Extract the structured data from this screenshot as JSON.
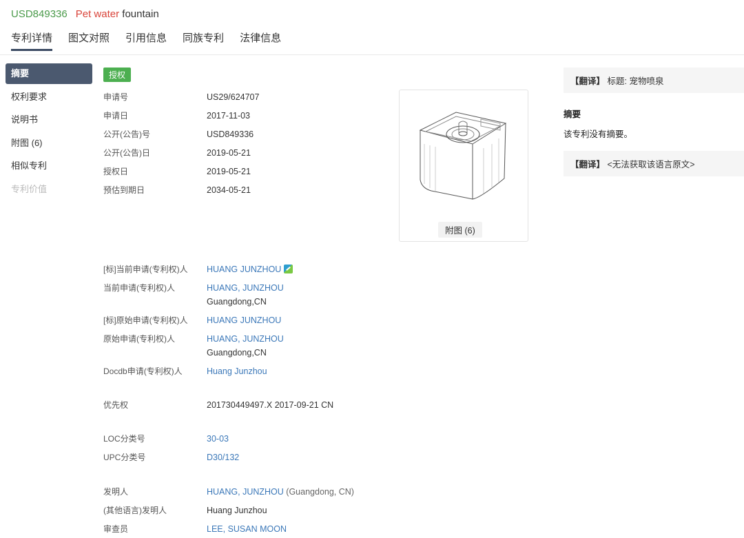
{
  "header": {
    "pub_number": "USD849336",
    "title_red": "Pet water",
    "title_dark": "fountain",
    "tabs": [
      "专利详情",
      "图文对照",
      "引用信息",
      "同族专利",
      "法律信息"
    ]
  },
  "sidebar": {
    "items": [
      {
        "label": "摘要"
      },
      {
        "label": "权利要求"
      },
      {
        "label": "说明书"
      },
      {
        "label": "附图 (6)"
      },
      {
        "label": "相似专利"
      },
      {
        "label": "专利价值"
      }
    ]
  },
  "status_badge": "授权",
  "fields": {
    "app_no_label": "申请号",
    "app_no": "US29/624707",
    "app_date_label": "申请日",
    "app_date": "2017-11-03",
    "pub_no_label": "公开(公告)号",
    "pub_no": "USD849336",
    "pub_date_label": "公开(公告)日",
    "pub_date": "2019-05-21",
    "grant_date_label": "授权日",
    "grant_date": "2019-05-21",
    "expiry_label": "预估到期日",
    "expiry": "2034-05-21",
    "std_applicant_label": "[标]当前申请(专利权)人",
    "std_applicant": "HUANG JUNZHOU",
    "cur_applicant_label": "当前申请(专利权)人",
    "cur_applicant": "HUANG, JUNZHOU",
    "cur_applicant_loc": "Guangdong,CN",
    "std_orig_label": "[标]原始申请(专利权)人",
    "std_orig": "HUANG JUNZHOU",
    "orig_applicant_label": "原始申请(专利权)人",
    "orig_applicant": "HUANG, JUNZHOU",
    "orig_applicant_loc": "Guangdong,CN",
    "docdb_label": "Docdb申请(专利权)人",
    "docdb": "Huang Junzhou",
    "priority_label": "优先权",
    "priority": "201730449497.X 2017-09-21 CN",
    "loc_label": "LOC分类号",
    "loc": "30-03",
    "upc_label": "UPC分类号",
    "upc": "D30/132",
    "inventor_label": "发明人",
    "inventor": "HUANG, JUNZHOU",
    "inventor_loc": "(Guangdong, CN)",
    "other_inventor_label": "(其他语言)发明人",
    "other_inventor": "Huang Junzhou",
    "examiner_label": "审查员",
    "examiner": "LEE, SUSAN MOON"
  },
  "figure": {
    "label": "附图 (6)"
  },
  "right_panel": {
    "trans1_tag": "【翻译】",
    "trans1_text": "标题: 宠物喷泉",
    "abstract_title": "摘要",
    "abstract_text": "该专利没有摘要。",
    "trans2_tag": "【翻译】",
    "trans2_text": "<无法获取该语言原文>"
  },
  "colors": {
    "green": "#4a9a4a",
    "red": "#d9443a",
    "link": "#3a77b8",
    "sidebar_active": "#4b596f",
    "badge": "#4caf50"
  }
}
